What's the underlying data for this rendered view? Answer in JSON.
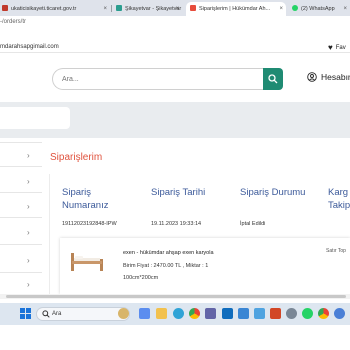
{
  "browser": {
    "tabs": [
      {
        "label": "ukaticisikayeti.ticaret.gov.tr",
        "icon": "government-icon",
        "color": "#c0392b"
      },
      {
        "label": "Şikayetvar - Şikayetvar",
        "icon": "sikayetvar-icon",
        "color": "#2a9d8f"
      },
      {
        "label": "Siparişlerim | Hükümdar Ah...",
        "icon": "store-icon",
        "color": "#e74c3c",
        "active": true
      },
      {
        "label": "(2) WhatsApp",
        "icon": "whatsapp-icon",
        "color": "#25d366"
      }
    ],
    "url": "-/orders/tr"
  },
  "bookmarks": {
    "email": "mdarahsapgimail.com",
    "favorites_label": "Fav"
  },
  "header": {
    "search_placeholder": "Ara...",
    "account_label": "Hesabın",
    "accent": "#1f8b73"
  },
  "page": {
    "title": "Siparişlerim",
    "title_color": "#e0533e"
  },
  "orders": {
    "columns": [
      {
        "line1": "Sipariş",
        "line2": "Numaranız"
      },
      {
        "line1": "Sipariş Tarihi",
        "line2": ""
      },
      {
        "line1": "Sipariş Durumu",
        "line2": ""
      },
      {
        "line1": "Karg",
        "line2": "Takip"
      }
    ],
    "rows": [
      {
        "number": "19112023192848-IPW",
        "date": "19.11.2023 19:33:14",
        "status": "İptal Edildi"
      }
    ],
    "product": {
      "name": "exen - hükümdar ahşap exen karyola",
      "price_line": "Birim Fiyat : 2470.00 TL , Miktar : 1",
      "size": "100cm*200cm",
      "total_label": "Satır Top"
    }
  },
  "taskbar": {
    "search_label": "Ara",
    "icons": [
      "weather-icon",
      "widgets-icon",
      "file-explorer-icon",
      "edge-icon",
      "chrome-icon",
      "teams-icon",
      "mail-icon",
      "store-icon",
      "photos-icon",
      "powerpoint-icon",
      "settings-icon",
      "whatsapp-icon",
      "chrome-profile-icon",
      "extra-icon"
    ]
  }
}
